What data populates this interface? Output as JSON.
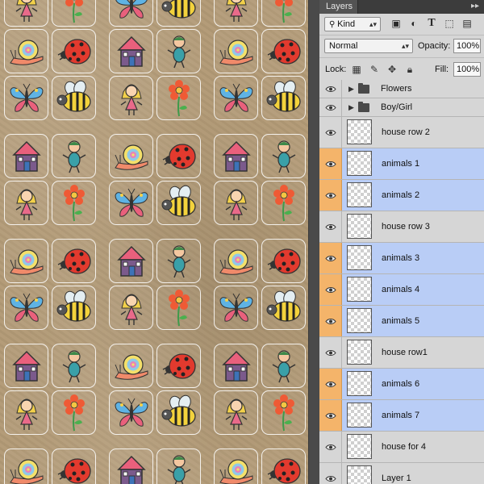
{
  "panel": {
    "tab_label": "Layers",
    "menu_glyph": "▸▸",
    "filter": {
      "kind_label": "Kind"
    },
    "blend_mode": "Normal",
    "opacity_label": "Opacity:",
    "opacity_value": "100%",
    "lock_label": "Lock:",
    "fill_label": "Fill:",
    "fill_value": "100%"
  },
  "layers": [
    {
      "name": "Flowers",
      "type": "group",
      "selected": false
    },
    {
      "name": "Boy/Girl",
      "type": "group",
      "selected": false
    },
    {
      "name": "house row 2",
      "type": "layer",
      "selected": false
    },
    {
      "name": "animals 1",
      "type": "layer",
      "selected": true
    },
    {
      "name": "animals 2",
      "type": "layer",
      "selected": true
    },
    {
      "name": "house row 3",
      "type": "layer",
      "selected": false
    },
    {
      "name": "animals 3",
      "type": "layer",
      "selected": true
    },
    {
      "name": "animals 4",
      "type": "layer",
      "selected": true
    },
    {
      "name": "animals 5",
      "type": "layer",
      "selected": true
    },
    {
      "name": "house row1",
      "type": "layer",
      "selected": false
    },
    {
      "name": "animals 6",
      "type": "layer",
      "selected": true
    },
    {
      "name": "animals 7",
      "type": "layer",
      "selected": true
    },
    {
      "name": "house for 4",
      "type": "layer",
      "selected": false
    },
    {
      "name": "Layer 1",
      "type": "layer",
      "selected": false
    }
  ],
  "canvas": {
    "icons": [
      "house-icon",
      "boy-icon",
      "snail-icon",
      "ladybug-icon",
      "girl-icon",
      "flower-icon",
      "butterfly-icon",
      "bee-icon"
    ]
  }
}
